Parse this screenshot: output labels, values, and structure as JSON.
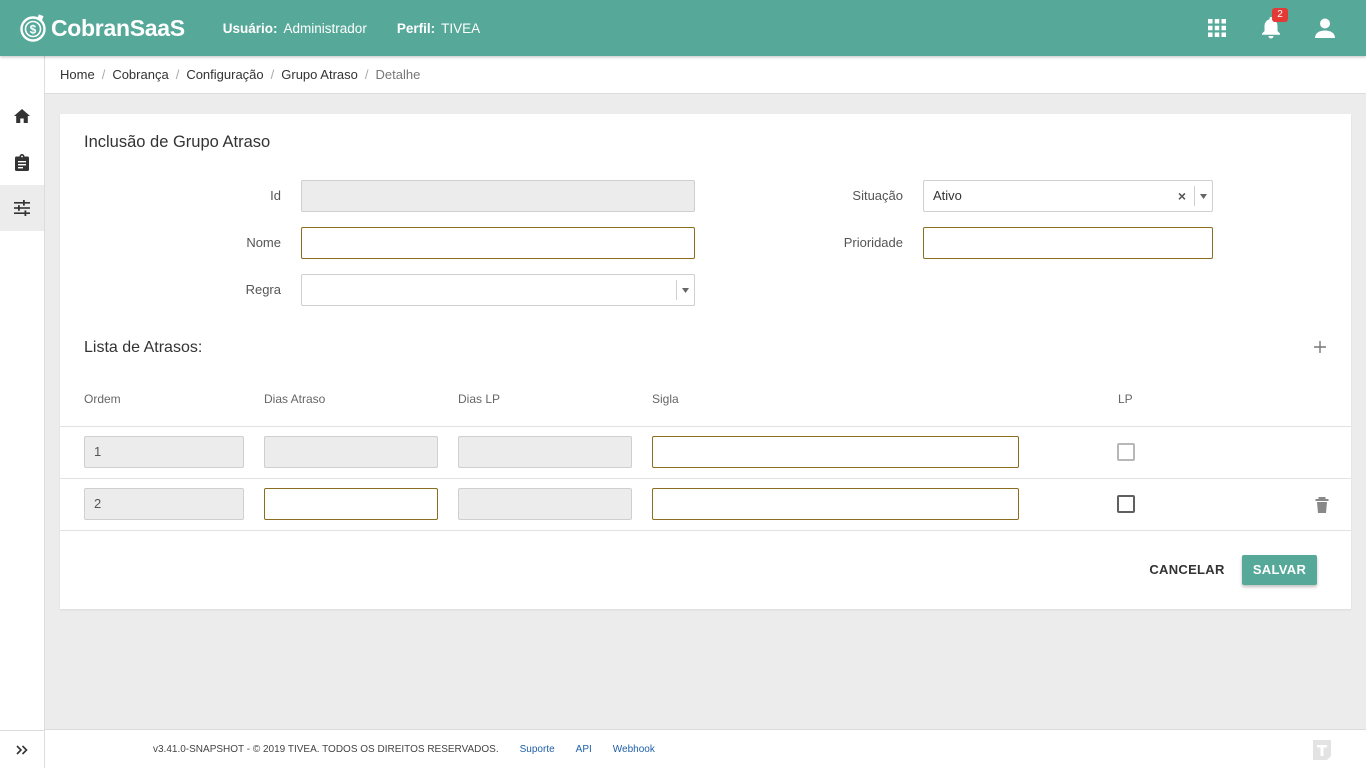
{
  "header": {
    "logo_text": "CobranSaaS",
    "user_label": "Usuário:",
    "user_value": "Administrador",
    "perfil_label": "Perfil:",
    "perfil_value": "TIVEA",
    "notification_count": "2",
    "icons": [
      "apps-grid-icon",
      "bell-icon",
      "user-icon"
    ]
  },
  "sidebar": {
    "items": [
      {
        "icon": "home-icon"
      },
      {
        "icon": "clipboard-icon"
      },
      {
        "icon": "settings-sliders-icon",
        "active": true
      }
    ],
    "expand_icon": "double-chevron-right-icon"
  },
  "breadcrumb": [
    "Home",
    "Cobrança",
    "Configuração",
    "Grupo Atraso",
    "Detalhe"
  ],
  "form": {
    "title": "Inclusão de Grupo Atraso",
    "id_label": "Id",
    "id_value": "",
    "nome_label": "Nome",
    "nome_value": "",
    "regra_label": "Regra",
    "regra_value": "",
    "situacao_label": "Situação",
    "situacao_value": "Ativo",
    "prioridade_label": "Prioridade",
    "prioridade_value": ""
  },
  "list": {
    "title": "Lista de Atrasos:",
    "columns": [
      "Ordem",
      "Dias Atraso",
      "Dias LP",
      "Sigla",
      "LP"
    ],
    "rows": [
      {
        "ordem": "1",
        "dias_atraso": "",
        "dias_lp": "",
        "sigla": "",
        "lp": false
      },
      {
        "ordem": "2",
        "dias_atraso": "",
        "dias_lp": "",
        "sigla": "",
        "lp": false
      }
    ]
  },
  "actions": {
    "cancel_label": "CANCELAR",
    "save_label": "SALVAR"
  },
  "footer": {
    "version": "v3.41.0-SNAPSHOT - © 2019 TIVEA. TODOS OS DIREITOS RESERVADOS.",
    "links": [
      "Suporte",
      "API",
      "Webhook"
    ]
  },
  "colors": {
    "primary": "#56a899",
    "input_border": "#8a6d1e",
    "badge": "#e53935",
    "link": "#1e5fa8"
  }
}
